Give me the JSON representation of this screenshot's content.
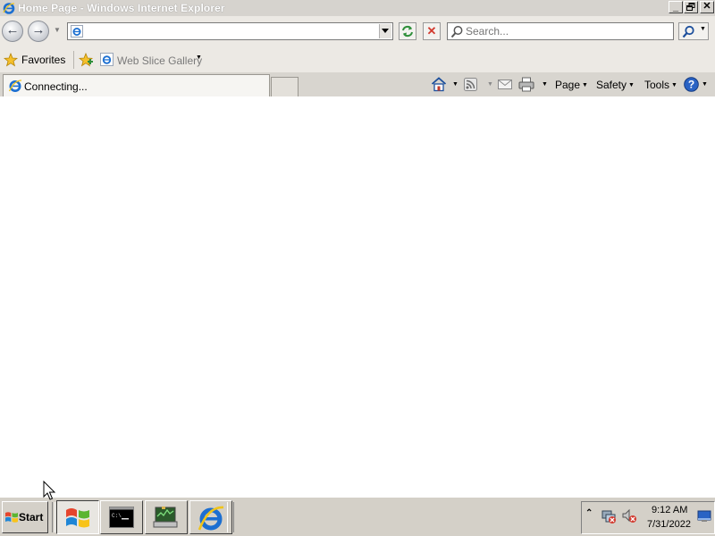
{
  "window": {
    "title": "Home Page - Windows Internet Explorer",
    "controls": [
      "minimize",
      "restore",
      "close"
    ]
  },
  "navbar": {
    "address_value": "",
    "search_placeholder": "Search..."
  },
  "favorites_bar": {
    "favorites_label": "Favorites",
    "web_slice_gallery_label": "Web Slice Gallery"
  },
  "tabs": [
    {
      "label": "Connecting...",
      "active": true
    }
  ],
  "command_bar": {
    "page_label": "Page",
    "safety_label": "Safety",
    "tools_label": "Tools"
  },
  "taskbar": {
    "start_label": "Start",
    "time": "9:12 AM",
    "date": "7/31/2022"
  },
  "colors": {
    "ie_blue": "#1c6fd1",
    "taskbar_gray": "#d4d0c8",
    "stop_red": "#d23a2f",
    "refresh_green": "#2f8f3a"
  }
}
